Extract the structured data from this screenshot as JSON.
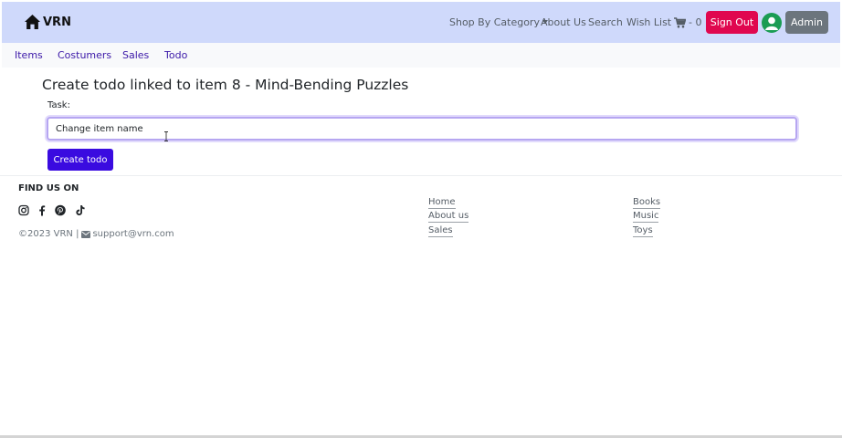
{
  "navbar": {
    "brand": "VRN",
    "shop_by_category": "Shop By Category",
    "about_us": "About Us",
    "search": "Search",
    "wish_list": "Wish List",
    "cart_count": "- 0",
    "sign_out": "Sign Out",
    "admin": "Admin",
    "colors": {
      "background": "#cfd9fb",
      "sign_out": "#e0074f",
      "admin": "#6c757d",
      "avatar": "#1a9c53"
    }
  },
  "subnav": {
    "items": [
      "Items",
      "Costumers",
      "Sales",
      "Todo"
    ]
  },
  "form": {
    "heading": "Create todo linked to item 8 - Mind-Bending Puzzles",
    "task_label": "Task:",
    "task_value": "Change item name",
    "submit": "Create todo",
    "colors": {
      "submit": "#3a0be0",
      "focus_border": "#b6a6f1"
    }
  },
  "footer": {
    "find_us_heading": "FIND US ON",
    "social_icons": [
      "instagram-icon",
      "facebook-icon",
      "pinterest-icon",
      "tiktok-icon"
    ],
    "copyright": "©2023 VRN |",
    "email": "support@vrn.com",
    "links_col1": [
      "Home",
      "About us",
      "Sales"
    ],
    "links_col2": [
      "Books",
      "Music",
      "Toys"
    ]
  }
}
